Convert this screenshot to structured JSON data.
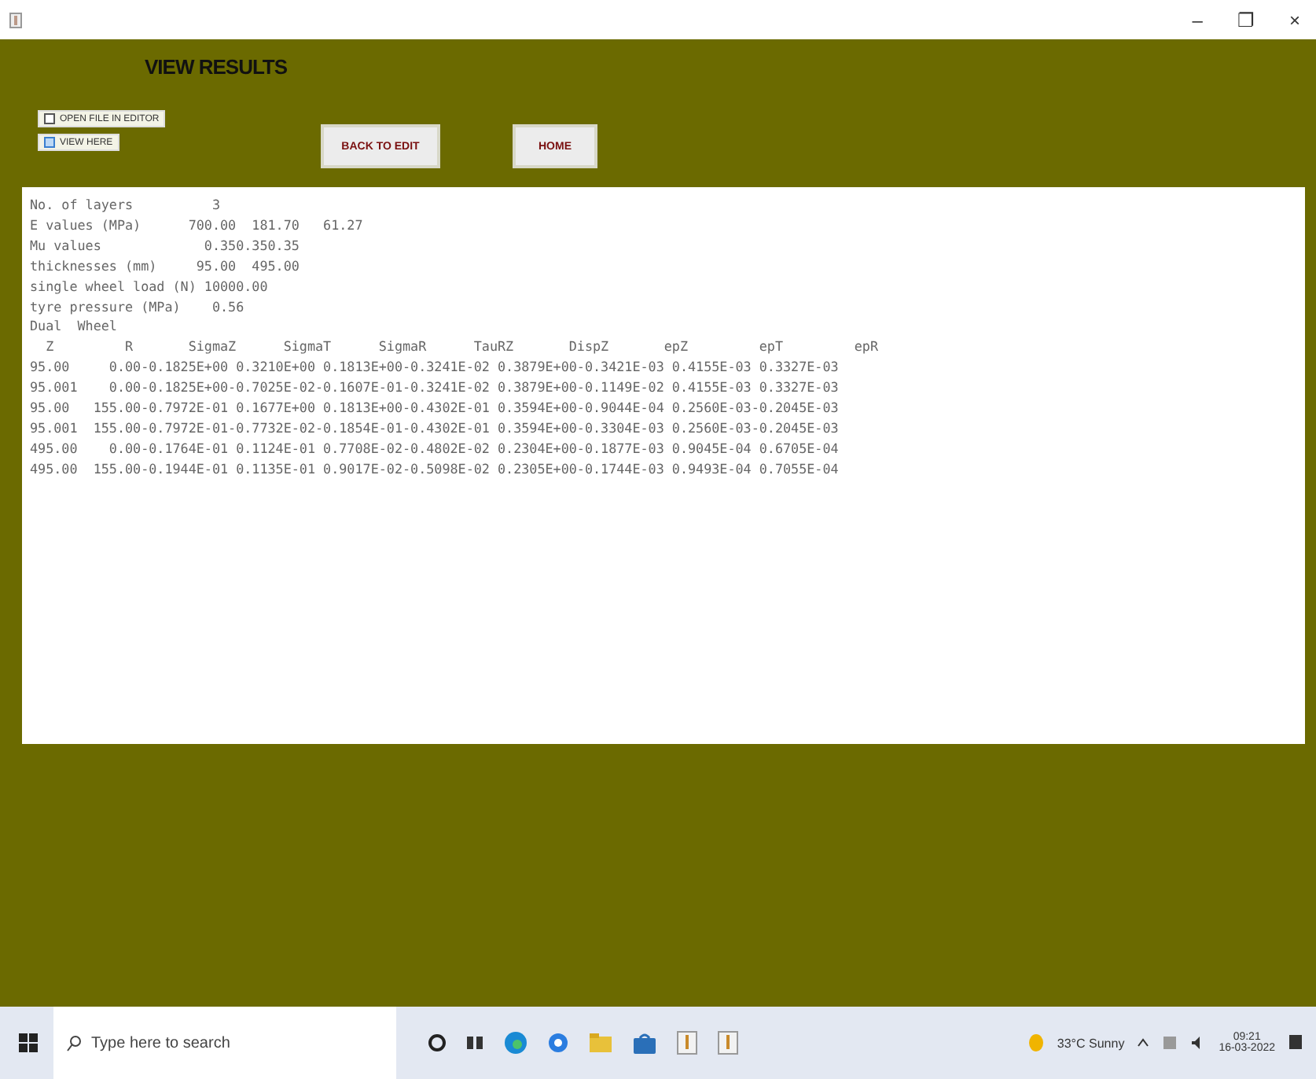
{
  "window": {
    "controls": [
      "–",
      "❐",
      "×"
    ]
  },
  "title": "VIEW RESULTS",
  "options": [
    {
      "label": "OPEN FILE IN EDITOR",
      "checked": false
    },
    {
      "label": "VIEW HERE",
      "checked": true
    }
  ],
  "buttons": [
    "BACK TO EDIT",
    "HOME"
  ],
  "output_lines": [
    "No. of layers          3",
    "E values (MPa)      700.00  181.70   61.27",
    "Mu values             0.350.350.35",
    "thicknesses (mm)     95.00  495.00",
    "single wheel load (N) 10000.00",
    "tyre pressure (MPa)    0.56",
    "Dual  Wheel",
    "  Z         R       SigmaZ      SigmaT      SigmaR      TauRZ       DispZ       epZ         epT         epR",
    "95.00     0.00-0.1825E+00 0.3210E+00 0.1813E+00-0.3241E-02 0.3879E+00-0.3421E-03 0.4155E-03 0.3327E-03",
    "95.001    0.00-0.1825E+00-0.7025E-02-0.1607E-01-0.3241E-02 0.3879E+00-0.1149E-02 0.4155E-03 0.3327E-03",
    "95.00   155.00-0.7972E-01 0.1677E+00 0.1813E+00-0.4302E-01 0.3594E+00-0.9044E-04 0.2560E-03-0.2045E-03",
    "95.001  155.00-0.7972E-01-0.7732E-02-0.1854E-01-0.4302E-01 0.3594E+00-0.3304E-03 0.2560E-03-0.2045E-03",
    "495.00    0.00-0.1764E-01 0.1124E-01 0.7708E-02-0.4802E-02 0.2304E+00-0.1877E-03 0.9045E-04 0.6705E-04",
    "495.00  155.00-0.1944E-01 0.1135E-01 0.9017E-02-0.5098E-02 0.2305E+00-0.1744E-03 0.9493E-04 0.7055E-04"
  ],
  "taskbar": {
    "search_placeholder": "Type here to search",
    "weather": "33°C Sunny",
    "time": "09:21",
    "date": "16-03-2022"
  }
}
